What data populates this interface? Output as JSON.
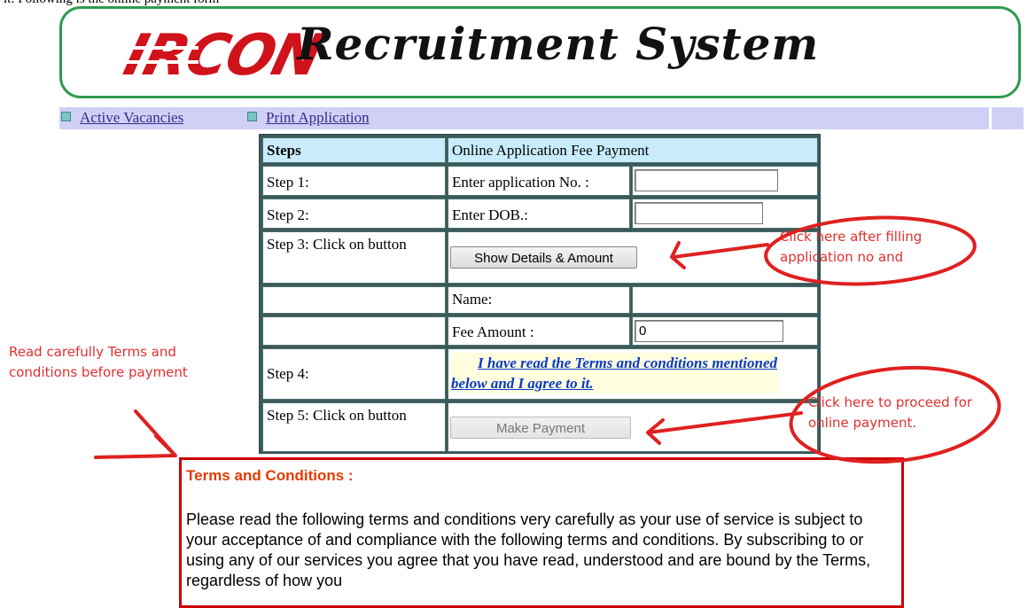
{
  "header": {
    "cut_text": "it: Following is the online payment form",
    "logo_text": "IRCON",
    "title": "Recruitment System"
  },
  "nav": {
    "items": [
      {
        "label": "Active Vacancies"
      },
      {
        "label": "Print Application"
      }
    ]
  },
  "form": {
    "header_steps": "Steps",
    "header_title": "Online Application Fee Payment",
    "step1": "Step 1:",
    "step1_label": "Enter application No. :",
    "step1_value": "",
    "step2": "Step 2:",
    "step2_label": "Enter DOB.:",
    "step2_value": "",
    "step3": "Step 3: Click on button",
    "step3_button": "Show Details & Amount",
    "name_label": "Name:",
    "name_value": "",
    "fee_label": "Fee Amount :",
    "fee_value": "0",
    "step4": "Step 4:",
    "agree_text": "I have read the Terms and conditions mentioned below and I agree to it.",
    "step5": "Step 5: Click on button",
    "step5_button": "Make Payment"
  },
  "terms": {
    "title": "Terms and Conditions :",
    "body": "Please read the following terms and conditions very carefully as your use of service is subject to your acceptance of and compliance with the following terms and conditions. By subscribing to or using any of our services you agree that you have read, understood and are bound by the Terms, regardless of how you"
  },
  "annotations": {
    "note_terms": "Read carefully Terms and conditions before payment",
    "note_show": "Click here after filling application no and",
    "note_pay": "Click here to proceed for online payment."
  },
  "colors": {
    "brand_red": "#d0121b",
    "banner_border": "#2e9a4e",
    "nav_bg": "#d0d0f6",
    "annotation_red": "#e03030"
  }
}
